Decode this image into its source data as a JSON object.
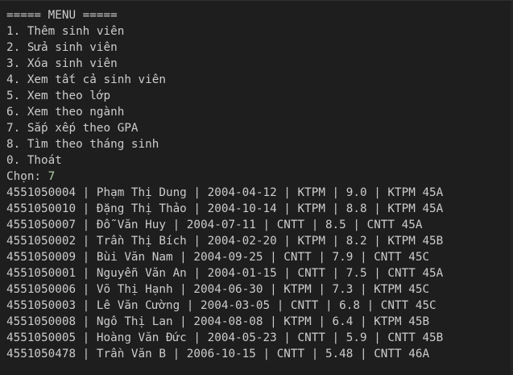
{
  "menu": {
    "header": "===== MENU =====",
    "items": [
      "1. Thêm sinh viên",
      "2. Sửa sinh viên",
      "3. Xóa sinh viên",
      "4. Xem tất cả sinh viên",
      "5. Xem theo lớp",
      "6. Xem theo ngành",
      "7. Sắp xếp theo GPA",
      "8. Tìm theo tháng sinh",
      "0. Thoát"
    ],
    "prompt_label": "Chọn: ",
    "prompt_value": "7"
  },
  "results": [
    "4551050004 | Phạm Thị Dung | 2004-04-12 | KTPM | 9.0 | KTPM 45A",
    "4551050010 | Đặng Thị Thảo | 2004-10-14 | KTPM | 8.8 | KTPM 45A",
    "4551050007 | Đỗ Văn Huy | 2004-07-11 | CNTT | 8.5 | CNTT 45A",
    "4551050002 | Trần Thị Bích | 2004-02-20 | KTPM | 8.2 | KTPM 45B",
    "4551050009 | Bùi Văn Nam | 2004-09-25 | CNTT | 7.9 | CNTT 45C",
    "4551050001 | Nguyễn Văn An | 2004-01-15 | CNTT | 7.5 | CNTT 45A",
    "4551050006 | Võ Thị Hạnh | 2004-06-30 | KTPM | 7.3 | KTPM 45C",
    "4551050003 | Lê Văn Cường | 2004-03-05 | CNTT | 6.8 | CNTT 45C",
    "4551050008 | Ngô Thị Lan | 2004-08-08 | KTPM | 6.4 | KTPM 45B",
    "4551050005 | Hoàng Văn Đức | 2004-05-23 | CNTT | 5.9 | CNTT 45B",
    "4551050478 | Trần Văn B | 2006-10-15 | CNTT | 5.48 | CNTT 46A"
  ],
  "colors": {
    "background": "#1e1e1e",
    "text": "#cccccc",
    "input": "#b5cea8"
  }
}
